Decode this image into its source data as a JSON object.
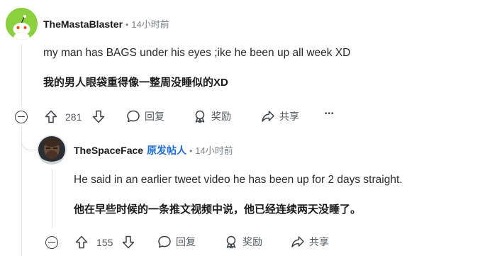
{
  "comment1": {
    "username": "TheMastaBlaster",
    "separator": "•",
    "time": "14小时前",
    "text": "my man has BAGS under his eyes ;ike he been up all week XD",
    "translation": "我的男人眼袋重得像一整周没睡似的XD",
    "votes": "281",
    "reply_label": "回复",
    "award_label": "奖励",
    "share_label": "共享",
    "more_label": "•••"
  },
  "comment2": {
    "username": "TheSpaceFace",
    "op_badge": "原发帖人",
    "separator": "•",
    "time": "14小时前",
    "text": "He said in an earlier tweet video he has been up for 2 days straight.",
    "translation": "他在早些时候的一条推文视频中说，他已经连续两天没睡了。",
    "votes": "155",
    "reply_label": "回复",
    "award_label": "奖励",
    "share_label": "共享"
  },
  "colors": {
    "op_badge": "#1f6ed4",
    "avatar1": "#8bd13f",
    "text_muted": "#7c8085"
  }
}
